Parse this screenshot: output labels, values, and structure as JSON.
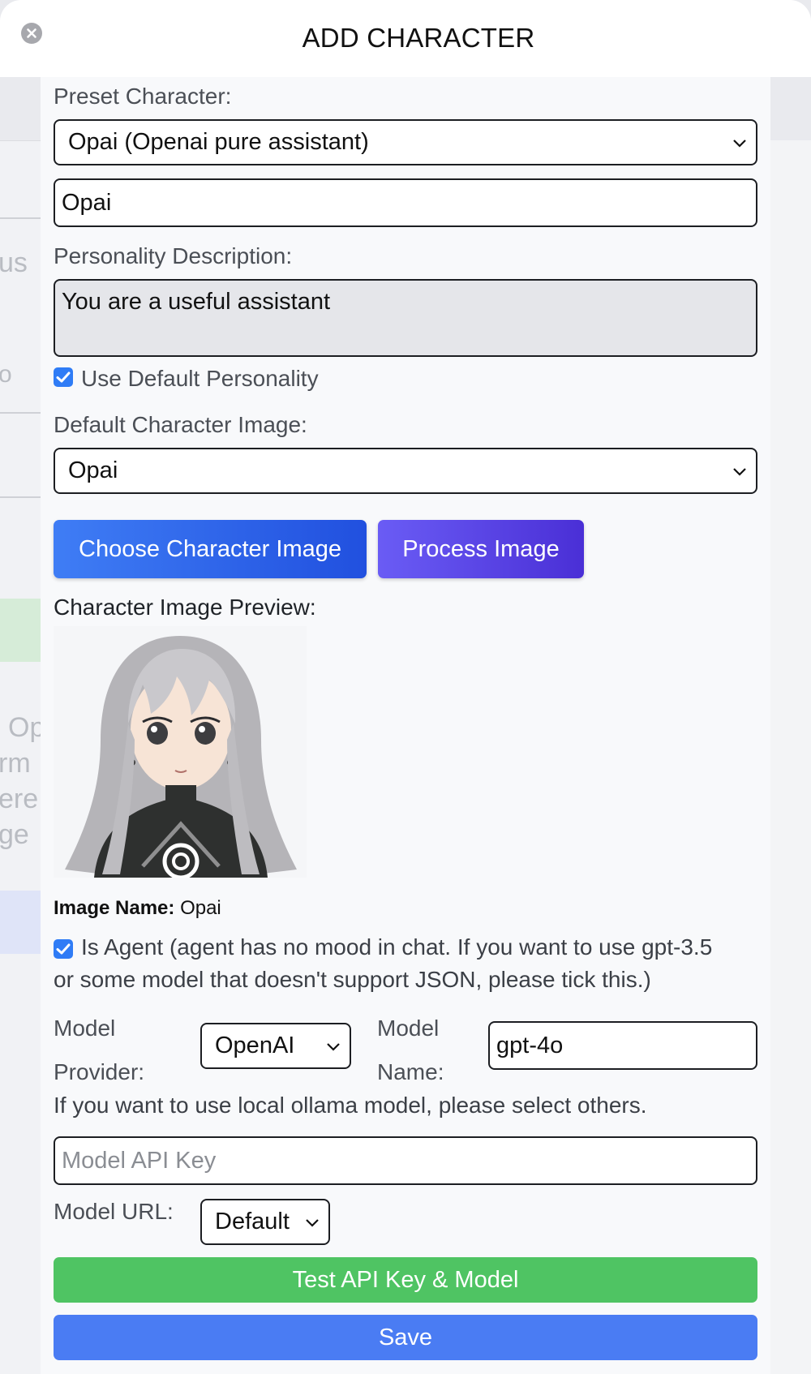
{
  "window": {
    "title": "ADD CHARACTER"
  },
  "background": {
    "ghost_text": [
      "us",
      "Op",
      "rm",
      "ere",
      "ge",
      "o"
    ]
  },
  "form": {
    "preset_label": "Preset Character:",
    "preset_value": "Opai (Openai pure assistant)",
    "name_value": "Opai",
    "personality_label": "Personality Description:",
    "personality_value": "You are a useful assistant",
    "use_default_personality": {
      "label": "Use Default Personality",
      "checked": true
    },
    "default_image_label": "Default Character Image:",
    "default_image_value": "Opai",
    "choose_image_button": "Choose Character Image",
    "process_image_button": "Process Image",
    "preview_label": "Character Image Preview:",
    "image_name_label": "Image Name:",
    "image_name_value": "Opai",
    "is_agent": {
      "label_line1": "Is Agent (agent has no mood in chat. If you want to use gpt-3.5",
      "label_line2": "or some model that doesn't support JSON, please tick this.)",
      "checked": true
    },
    "model_provider_label_1": "Model",
    "model_provider_label_2": "Provider:",
    "model_provider_value": "OpenAI",
    "model_name_label_1": "Model",
    "model_name_label_2": "Name:",
    "model_name_value": "gpt-4o",
    "ollama_hint": "If you want to use local ollama model, please select others.",
    "api_key_placeholder": "Model API Key",
    "model_url_label": "Model URL:",
    "model_url_value": "Default",
    "test_button": "Test API Key & Model",
    "save_button": "Save"
  },
  "colors": {
    "checkbox": "#2f7cf6",
    "choose_button": "#2f64ea",
    "process_button": "#5a45e6",
    "test_button": "#4fc463",
    "save_button": "#4a7cf3"
  }
}
